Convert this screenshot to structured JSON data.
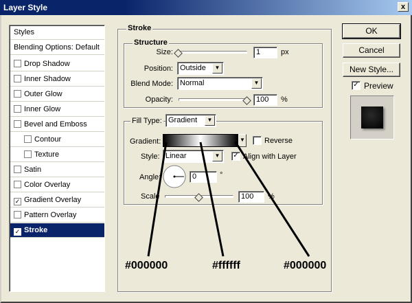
{
  "window": {
    "title": "Layer Style",
    "close_label": "x"
  },
  "sidebar": {
    "items": [
      {
        "label": "Styles",
        "checkbox": false,
        "checked": false,
        "indent": false,
        "selected": false
      },
      {
        "label": "Blending Options: Default",
        "checkbox": false,
        "checked": false,
        "indent": false,
        "selected": false
      },
      {
        "label": "Drop Shadow",
        "checkbox": true,
        "checked": false,
        "indent": false,
        "selected": false
      },
      {
        "label": "Inner Shadow",
        "checkbox": true,
        "checked": false,
        "indent": false,
        "selected": false
      },
      {
        "label": "Outer Glow",
        "checkbox": true,
        "checked": false,
        "indent": false,
        "selected": false
      },
      {
        "label": "Inner Glow",
        "checkbox": true,
        "checked": false,
        "indent": false,
        "selected": false
      },
      {
        "label": "Bevel and Emboss",
        "checkbox": true,
        "checked": false,
        "indent": false,
        "selected": false
      },
      {
        "label": "Contour",
        "checkbox": true,
        "checked": false,
        "indent": true,
        "selected": false
      },
      {
        "label": "Texture",
        "checkbox": true,
        "checked": false,
        "indent": true,
        "selected": false
      },
      {
        "label": "Satin",
        "checkbox": true,
        "checked": false,
        "indent": false,
        "selected": false
      },
      {
        "label": "Color Overlay",
        "checkbox": true,
        "checked": false,
        "indent": false,
        "selected": false
      },
      {
        "label": "Gradient Overlay",
        "checkbox": true,
        "checked": true,
        "indent": false,
        "selected": false
      },
      {
        "label": "Pattern Overlay",
        "checkbox": true,
        "checked": false,
        "indent": false,
        "selected": false
      },
      {
        "label": "Stroke",
        "checkbox": true,
        "checked": true,
        "indent": false,
        "selected": true
      }
    ]
  },
  "stroke": {
    "title": "Stroke",
    "structure": {
      "title": "Structure",
      "size_label": "Size:",
      "size_value": "1",
      "size_unit": "px",
      "size_slider_level": 0.0,
      "position_label": "Position:",
      "position_value": "Outside",
      "blend_label": "Blend Mode:",
      "blend_value": "Normal",
      "opacity_label": "Opacity:",
      "opacity_value": "100",
      "opacity_unit": "%",
      "opacity_slider_level": 1.0
    },
    "fill": {
      "fill_type_label": "Fill Type:",
      "fill_type_value": "Gradient",
      "gradient_label": "Gradient:",
      "reverse_label": "Reverse",
      "reverse_checked": false,
      "style_label": "Style:",
      "style_value": "Linear",
      "align_label": "Align with Layer",
      "align_checked": true,
      "angle_label": "Angle:",
      "angle_value": "0",
      "angle_unit": "°",
      "scale_label": "Scale",
      "scale_value": "100",
      "scale_unit": "%",
      "scale_slider_level": 0.5
    }
  },
  "buttons": {
    "ok": "OK",
    "cancel": "Cancel",
    "new_style": "New Style..."
  },
  "preview": {
    "label": "Preview",
    "checked": true
  },
  "annotations": {
    "left": "#000000",
    "middle": "#ffffff",
    "right": "#000000"
  },
  "colors": {
    "title_bar": "#0a246a",
    "selection": "#0a246a",
    "face": "#ece9d8"
  }
}
